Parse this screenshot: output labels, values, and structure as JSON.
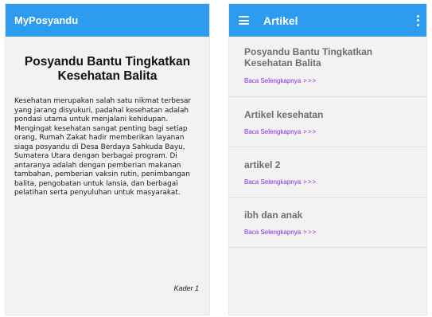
{
  "left_screen": {
    "app_title": "MyPosyandu",
    "article": {
      "title": "Posyandu Bantu Tingkatkan Kesehatan Balita",
      "body": "Kesehatan merupakan salah satu nikmat terbesar yang jarang disyukuri, padahal kesehatan adalah pondasi utama untuk menjalani kehidupan. Mengingat kesehatan sangat penting bagi setiap orang, Rumah Zakat hadir memberikan layanan siaga posyandu di Desa Berdaya Sahkuda Bayu, Sumatera Utara dengan berbagai program. Di antaranya adalah dengan pemberian makanan tambahan, pemberian vaksin rutin, penimbangan balita, pengobatan untuk lansia, dan berbagai pelatihan serta penyuluhan untuk masyarakat.",
      "author": "Kader 1"
    }
  },
  "right_screen": {
    "app_title": "Artikel",
    "menu_icon": "hamburger-menu-icon",
    "more_icon": "more-vertical-icon",
    "read_more_label": "Baca Selengkapnya",
    "read_more_chevrons": ">>>",
    "articles": [
      {
        "title": "Posyandu Bantu Tingkatkan Kesehatan Balita"
      },
      {
        "title": "Artikel kesehatan"
      },
      {
        "title": "artikel 2"
      },
      {
        "title": "ibh dan anak"
      }
    ]
  },
  "colors": {
    "appbar": "#2d9cf0",
    "background": "#f2f2f2",
    "link": "#8a2be2",
    "item_title": "#6e6e6e"
  }
}
